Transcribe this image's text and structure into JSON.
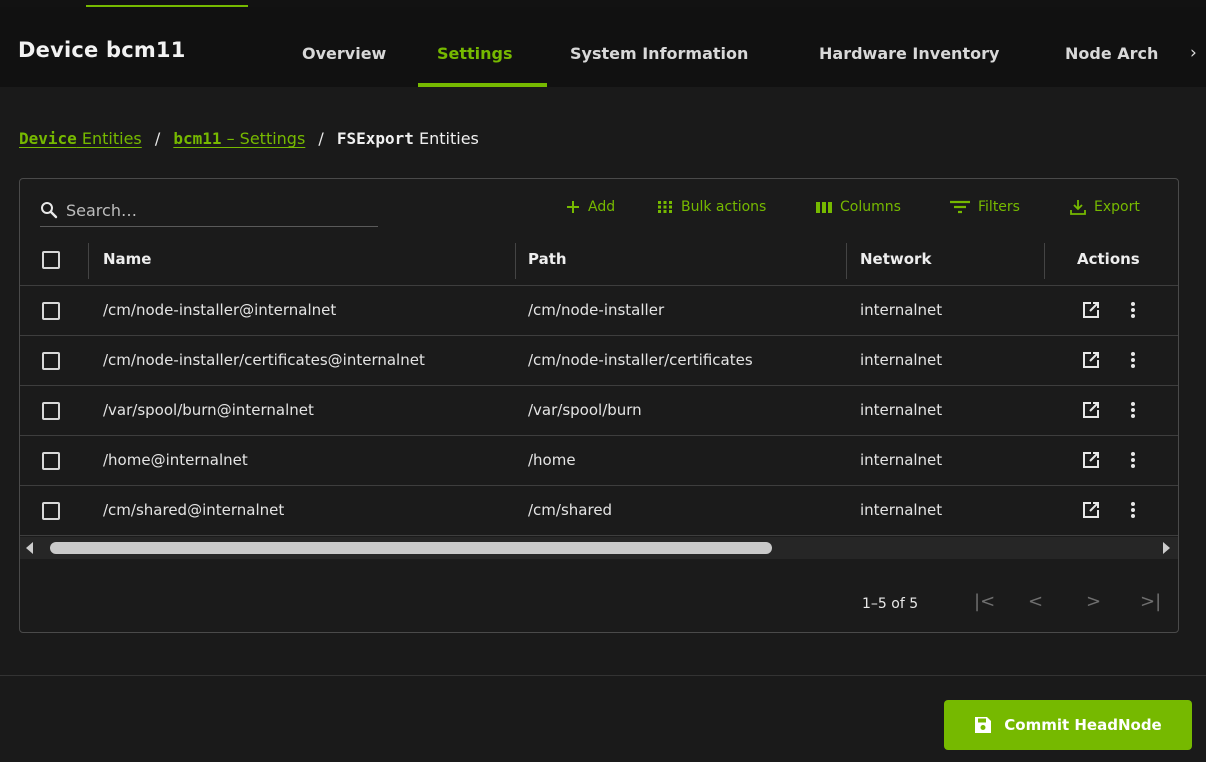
{
  "device": {
    "title": "Device bcm11"
  },
  "tabs": [
    {
      "label": "Overview"
    },
    {
      "label": "Settings",
      "active": true
    },
    {
      "label": "System Information"
    },
    {
      "label": "Hardware Inventory"
    },
    {
      "label": "Node Arch"
    }
  ],
  "breadcrumb": {
    "part1_bold": "Device",
    "part1_rest": " Entities",
    "part2_bold": "bcm11",
    "part2_rest": " – Settings",
    "separator": "/",
    "current_bold": "FSExport",
    "current_rest": " Entities"
  },
  "toolbar": {
    "search_placeholder": "Search…",
    "add": "Add",
    "bulk_actions": "Bulk actions",
    "columns": "Columns",
    "filters": "Filters",
    "export": "Export"
  },
  "table": {
    "headers": {
      "name": "Name",
      "path": "Path",
      "network": "Network",
      "actions": "Actions"
    },
    "rows": [
      {
        "name": "/cm/node-installer@internalnet",
        "path": "/cm/node-installer",
        "network": "internalnet"
      },
      {
        "name": "/cm/node-installer/certificates@internalnet",
        "path": "/cm/node-installer/certificates",
        "network": "internalnet"
      },
      {
        "name": "/var/spool/burn@internalnet",
        "path": "/var/spool/burn",
        "network": "internalnet"
      },
      {
        "name": "/home@internalnet",
        "path": "/home",
        "network": "internalnet"
      },
      {
        "name": "/cm/shared@internalnet",
        "path": "/cm/shared",
        "network": "internalnet"
      }
    ]
  },
  "pagination": {
    "range": "1–5 of 5"
  },
  "footer": {
    "commit_label": "Commit HeadNode"
  },
  "colors": {
    "accent": "#76b900",
    "background": "#1a1a1a",
    "header_bg": "#111111"
  }
}
